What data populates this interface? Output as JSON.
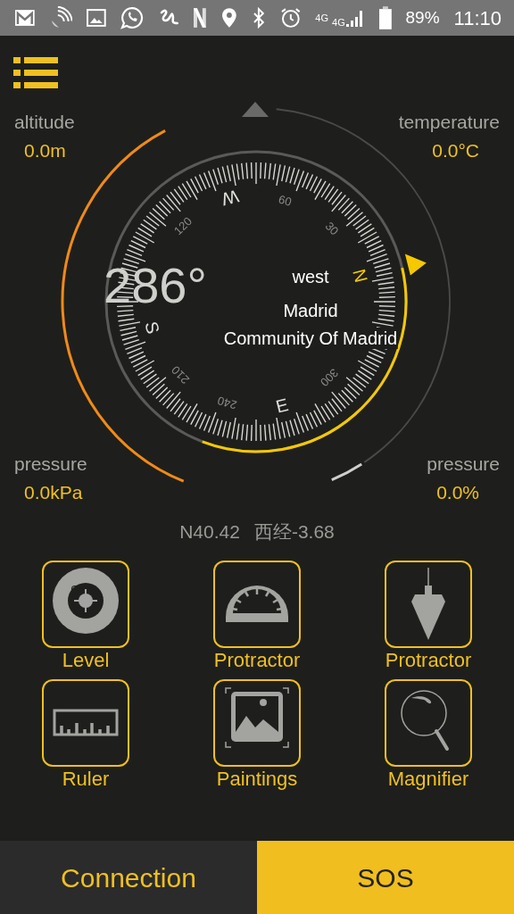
{
  "status_bar": {
    "network": [
      "4G",
      "4G"
    ],
    "battery": "89%",
    "time": "11:10"
  },
  "readings": {
    "altitude": {
      "label": "altitude",
      "value": "0.0m"
    },
    "temperature": {
      "label": "temperature",
      "value": "0.0°C"
    },
    "pressure": {
      "label": "pressure",
      "value": "0.0kPa"
    },
    "humidity": {
      "label": "pressure",
      "value": "0.0%"
    }
  },
  "compass": {
    "heading": "286°",
    "direction": "west",
    "city": "Madrid",
    "region": "Community Of Madrid",
    "dial": [
      {
        "text": "N",
        "kind": "letter",
        "highlighted": true
      },
      {
        "kind": "gap"
      },
      {
        "text": "300",
        "kind": "number"
      },
      {
        "text": "E",
        "kind": "letter",
        "highlighted": false
      },
      {
        "text": "240",
        "kind": "number"
      },
      {
        "text": "210",
        "kind": "number"
      },
      {
        "text": "S",
        "kind": "letter",
        "highlighted": false
      },
      {
        "kind": "gap"
      },
      {
        "text": "120",
        "kind": "number"
      },
      {
        "text": "W",
        "kind": "letter",
        "highlighted": false
      },
      {
        "text": "60",
        "kind": "number"
      },
      {
        "text": "30",
        "kind": "number"
      }
    ]
  },
  "coordinates": {
    "latitude": "N40.42",
    "longitude": "西经-3.68"
  },
  "tools": [
    {
      "label": "Level",
      "kind": "level"
    },
    {
      "label": "Protractor",
      "kind": "protractor"
    },
    {
      "label": "Protractor",
      "kind": "plumb"
    },
    {
      "label": "Ruler",
      "kind": "ruler"
    },
    {
      "label": "Paintings",
      "kind": "picture"
    },
    {
      "label": "Magnifier",
      "kind": "magnifier"
    }
  ],
  "bottom_buttons": [
    {
      "label": "Connection",
      "highlighted": false
    },
    {
      "label": "SOS",
      "highlighted": true
    }
  ]
}
